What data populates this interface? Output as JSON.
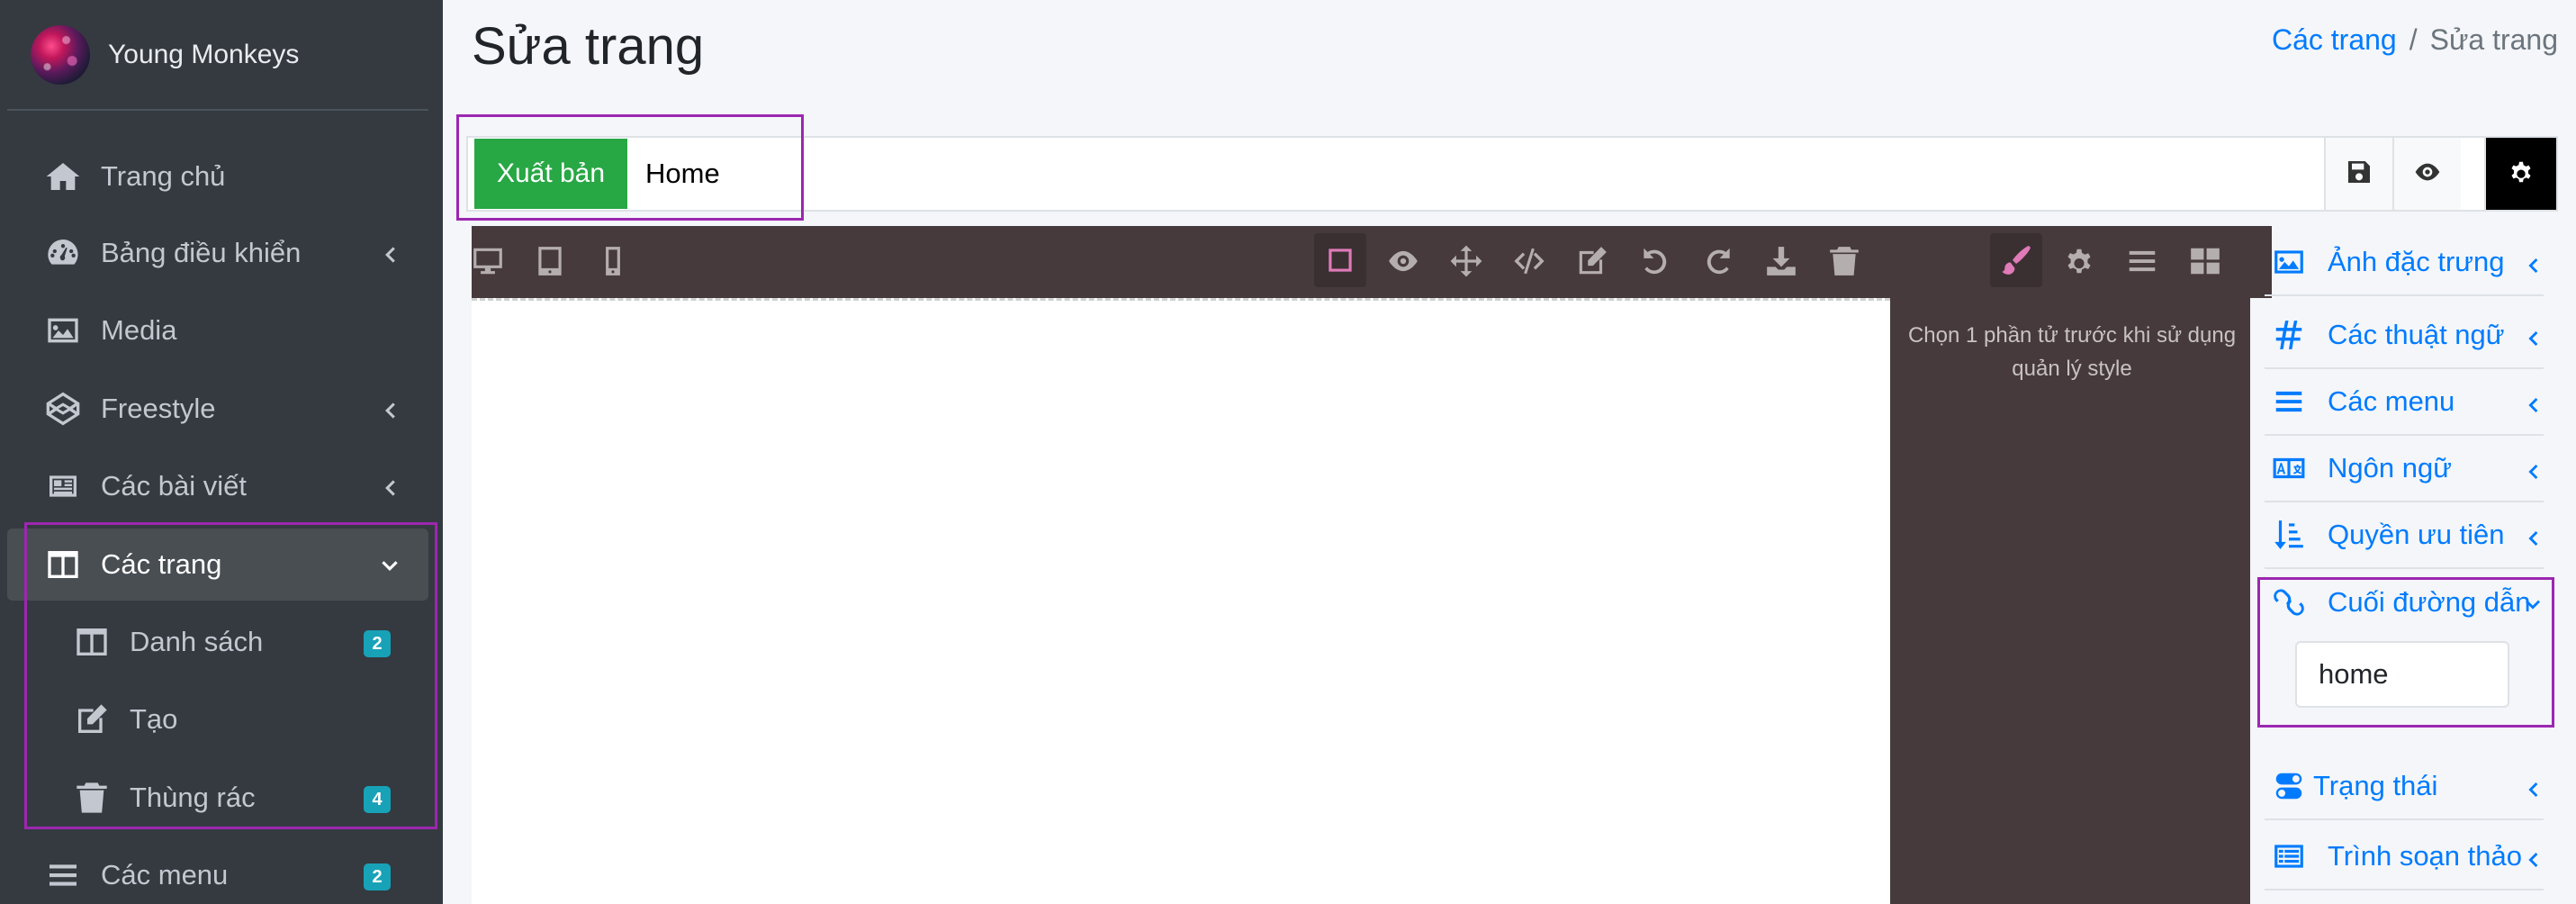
{
  "brand": {
    "name": "Young Monkeys"
  },
  "sidebar": {
    "items": [
      {
        "label": "Trang chủ",
        "icon": "home-icon"
      },
      {
        "label": "Bảng điều khiển",
        "icon": "dashboard-icon",
        "chevron": "left"
      },
      {
        "label": "Media",
        "icon": "image-icon"
      },
      {
        "label": "Freestyle",
        "icon": "codepen-icon",
        "chevron": "left"
      },
      {
        "label": "Các bài viết",
        "icon": "newspaper-icon",
        "chevron": "left"
      },
      {
        "label": "Các trang",
        "icon": "columns-icon",
        "chevron": "down",
        "active": true
      },
      {
        "label": "Danh sách",
        "icon": "columns-icon",
        "badge": "2"
      },
      {
        "label": "Tạo",
        "icon": "edit-icon"
      },
      {
        "label": "Thùng rác",
        "icon": "trash-icon",
        "badge": "4"
      },
      {
        "label": "Các menu",
        "icon": "bars-icon",
        "badge": "2"
      }
    ]
  },
  "header": {
    "title": "Sửa trang",
    "breadcrumb": {
      "link": "Các trang",
      "separator": "/",
      "current": "Sửa trang"
    }
  },
  "toolbar": {
    "publish_label": "Xuất bản",
    "title_value": "Home",
    "actions": [
      "save-icon",
      "eye-icon",
      "gear-icon"
    ]
  },
  "editor": {
    "device_icons": [
      "desktop-icon",
      "tablet-icon",
      "mobile-icon"
    ],
    "command_icons": [
      "square-icon",
      "eye-icon",
      "arrows-icon",
      "code-icon",
      "edit-icon",
      "undo-icon",
      "redo-icon",
      "download-icon",
      "trash-icon"
    ],
    "panel_icons": [
      "brush-icon",
      "gear-icon",
      "bars-icon",
      "blocks-icon"
    ],
    "style_message": "Chọn 1 phần tử trước khi sử dụng quản lý style"
  },
  "settings_panel": {
    "rows": [
      {
        "label": "Ảnh đặc trưng",
        "icon": "image-icon"
      },
      {
        "label": "Các thuật ngữ",
        "icon": "hashtag-icon"
      },
      {
        "label": "Các menu",
        "icon": "bars-icon"
      },
      {
        "label": "Ngôn ngữ",
        "icon": "language-icon"
      },
      {
        "label": "Quyền ưu tiên",
        "icon": "sort-icon"
      },
      {
        "label": "Cuối đường dẫn",
        "icon": "link-icon",
        "expanded": true
      },
      {
        "label": "Trạng thái",
        "icon": "toggle-icon"
      },
      {
        "label": "Trình soạn thảo",
        "icon": "list-icon"
      }
    ],
    "slug_value": "home"
  },
  "colors": {
    "sidebar_bg": "#343a40",
    "accent": "#007bff",
    "publish": "#28a745",
    "badge": "#17a2b8",
    "editor_bg": "#463a3c",
    "highlight": "#9c27b0"
  }
}
